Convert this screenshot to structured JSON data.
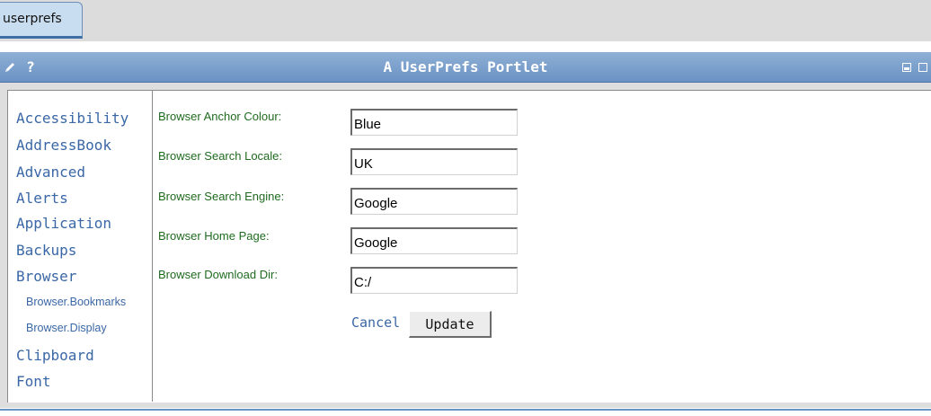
{
  "tabs": [
    {
      "label": "userprefs",
      "active": true
    }
  ],
  "portlet": {
    "title": "A UserPrefs Portlet",
    "help_label": "?",
    "icons": {
      "edit": "pencil-icon",
      "minimize": "minimize-icon",
      "maximize": "maximize-icon"
    }
  },
  "menu": {
    "items": [
      {
        "label": "Accessibility",
        "sub": false
      },
      {
        "label": "AddressBook",
        "sub": false
      },
      {
        "label": "Advanced",
        "sub": false
      },
      {
        "label": "Alerts",
        "sub": false
      },
      {
        "label": "Application",
        "sub": false
      },
      {
        "label": "Backups",
        "sub": false
      },
      {
        "label": "Browser",
        "sub": false
      },
      {
        "label": "Browser.Bookmarks",
        "sub": true
      },
      {
        "label": "Browser.Display",
        "sub": true
      },
      {
        "label": "Clipboard",
        "sub": false
      },
      {
        "label": "Font",
        "sub": false
      }
    ]
  },
  "form": {
    "fields": [
      {
        "label": "Browser Anchor Colour:",
        "value": "Blue"
      },
      {
        "label": "Browser Search Locale:",
        "value": "UK"
      },
      {
        "label": "Browser Search Engine:",
        "value": "Google"
      },
      {
        "label": "Browser Home Page:",
        "value": "Google"
      },
      {
        "label": "Browser Download Dir:",
        "value": "C:/"
      }
    ],
    "cancel_label": "Cancel",
    "update_label": "Update"
  },
  "colors": {
    "header": "#6a92c3",
    "link": "#3a67a6",
    "label": "#1f6b1f"
  }
}
